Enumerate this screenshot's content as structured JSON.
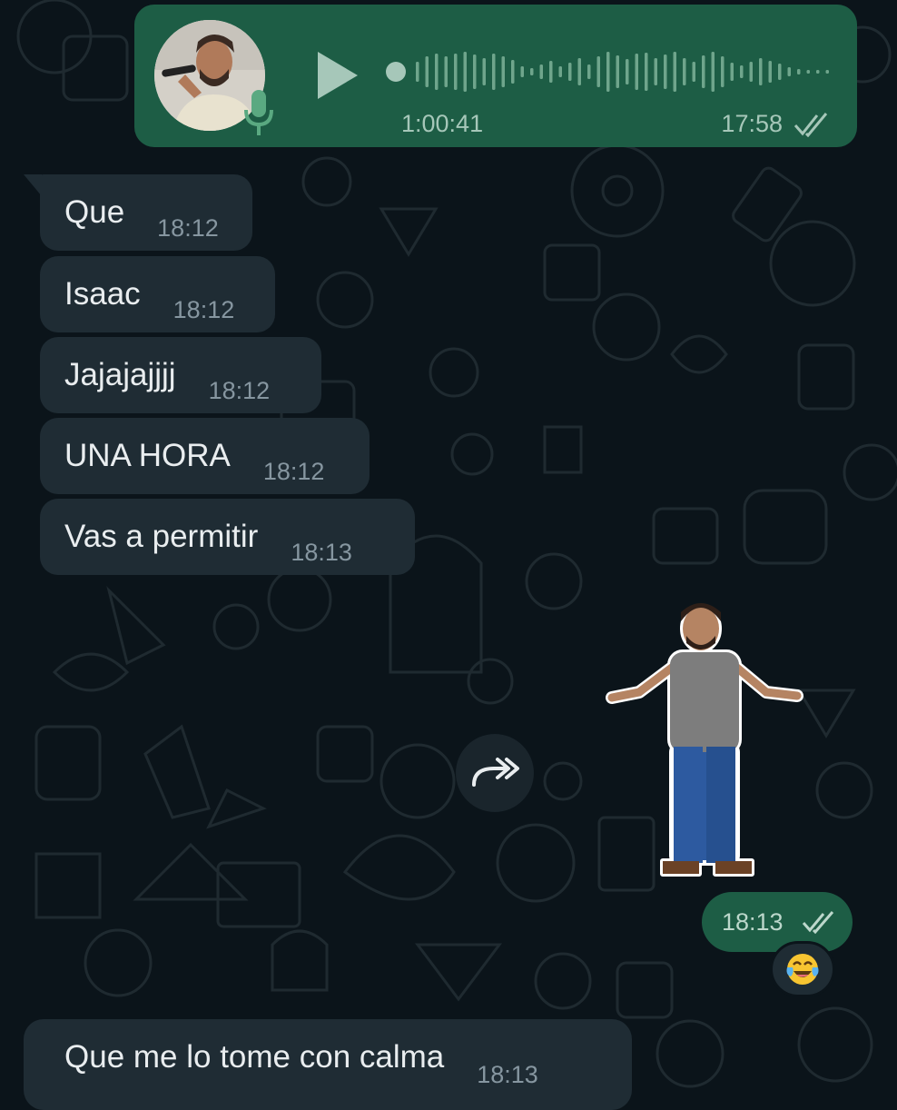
{
  "voice_message": {
    "duration": "1:00:41",
    "time": "17:58",
    "read_status": "read",
    "playback_progress": 0
  },
  "messages_incoming": [
    {
      "text": "Que",
      "time": "18:12"
    },
    {
      "text": "Isaac",
      "time": "18:12"
    },
    {
      "text": "Jajajajjjj",
      "time": "18:12"
    },
    {
      "text": "UNA HORA",
      "time": "18:12"
    },
    {
      "text": "Vas a permitir",
      "time": "18:13"
    }
  ],
  "sticker_message": {
    "time": "18:13",
    "read_status": "read",
    "reaction_icon": "face-with-tears-of-joy-emoji"
  },
  "last_message": {
    "text": "Que me lo tome con calma",
    "time": "18:13"
  },
  "colors": {
    "background": "#0b141a",
    "outgoing_bubble": "#1d5d45",
    "incoming_bubble": "#1f2c34",
    "read_ticks": "#53bdeb"
  },
  "icons": {
    "play": "play-icon",
    "mic": "microphone-icon",
    "forward": "forward-icon",
    "ticks": "double-check-icon"
  }
}
